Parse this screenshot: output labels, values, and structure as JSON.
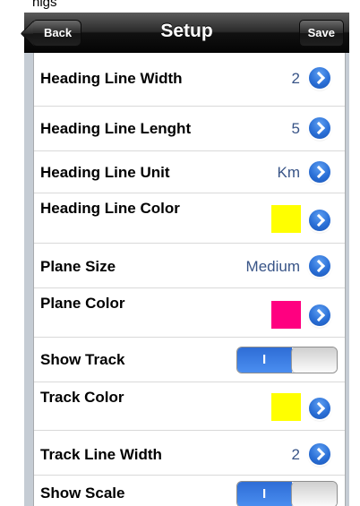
{
  "status_bar": {
    "partial_text": "nigs"
  },
  "navbar": {
    "title": "Setup",
    "back_label": "Back",
    "save_label": "Save"
  },
  "rows": [
    {
      "label": "Heading Line Width",
      "value": "2",
      "accessory": "disclosure"
    },
    {
      "label": "Heading Line Lenght",
      "value": "5",
      "accessory": "disclosure"
    },
    {
      "label": "Heading Line Unit",
      "value": "Km",
      "accessory": "disclosure"
    },
    {
      "label": "Heading Line Color",
      "color": "#ffff00",
      "accessory": "disclosure"
    },
    {
      "label": "Plane Size",
      "value": "Medium",
      "accessory": "disclosure"
    },
    {
      "label": "Plane Color",
      "color": "#ff0080",
      "accessory": "disclosure"
    },
    {
      "label": "Show Track",
      "switch": {
        "on": true,
        "on_label": "I"
      }
    },
    {
      "label": "Track Color",
      "color": "#ffff00",
      "accessory": "disclosure"
    },
    {
      "label": "Track Line Width",
      "value": "2",
      "accessory": "disclosure"
    },
    {
      "label": "Show Scale",
      "switch": {
        "on": true,
        "on_label": "I"
      }
    }
  ],
  "icons": {
    "disclosure": "chevron-right-circle-icon"
  },
  "colors": {
    "table_background": "#c5ccd4",
    "value_text": "#385487",
    "switch_on": "#2e6dd6"
  }
}
